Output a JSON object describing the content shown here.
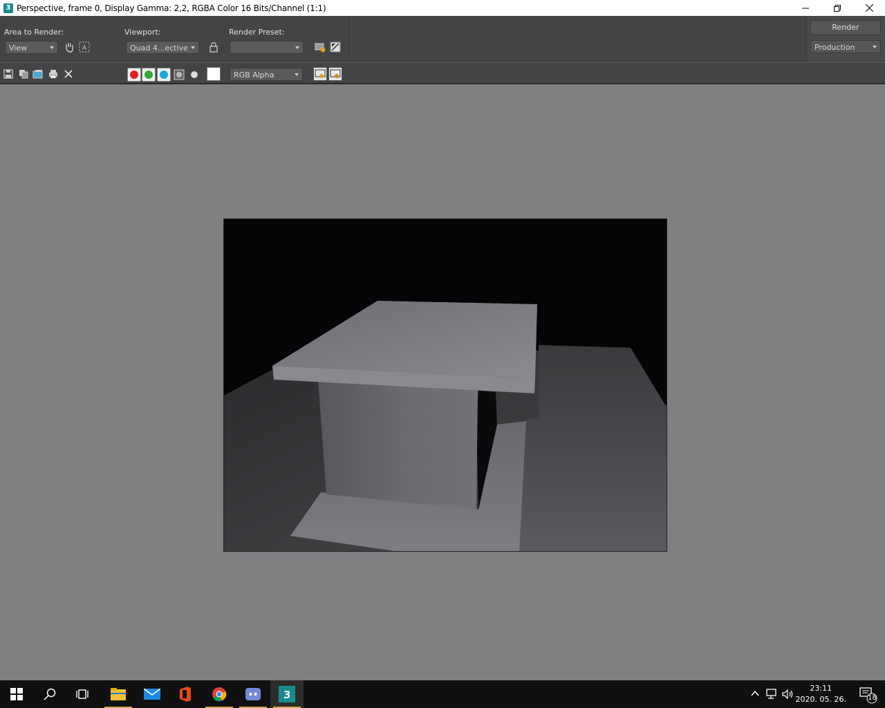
{
  "window": {
    "title": "Perspective, frame 0, Display Gamma: 2,2, RGBA Color 16 Bits/Channel (1:1)",
    "app_icon_text": "3"
  },
  "toolbar": {
    "area_label": "Area to Render:",
    "area_value": "View",
    "viewport_label": "Viewport:",
    "viewport_value": "Quad 4...ective",
    "preset_label": "Render Preset:",
    "preset_value": "",
    "render_button": "Render",
    "render_mode": "Production"
  },
  "toolbar2": {
    "channel_value": "RGB Alpha",
    "channels": [
      {
        "name": "red-channel",
        "color": "#e02020"
      },
      {
        "name": "green-channel",
        "color": "#2fa836"
      },
      {
        "name": "blue-channel",
        "color": "#1ea8e0"
      }
    ]
  },
  "taskbar": {
    "time": "23:11",
    "date": "2020. 05. 26.",
    "notifications": "18",
    "apps": [
      "start-icon",
      "search-icon",
      "task-view-icon",
      "file-explorer-icon",
      "mail-icon",
      "office-icon",
      "chrome-icon",
      "discord-icon",
      "3dsmax-icon"
    ]
  },
  "colors": {
    "toolbar_bg": "#444446",
    "canvas_bg": "#807f82",
    "taskbar_bg": "#101010"
  }
}
